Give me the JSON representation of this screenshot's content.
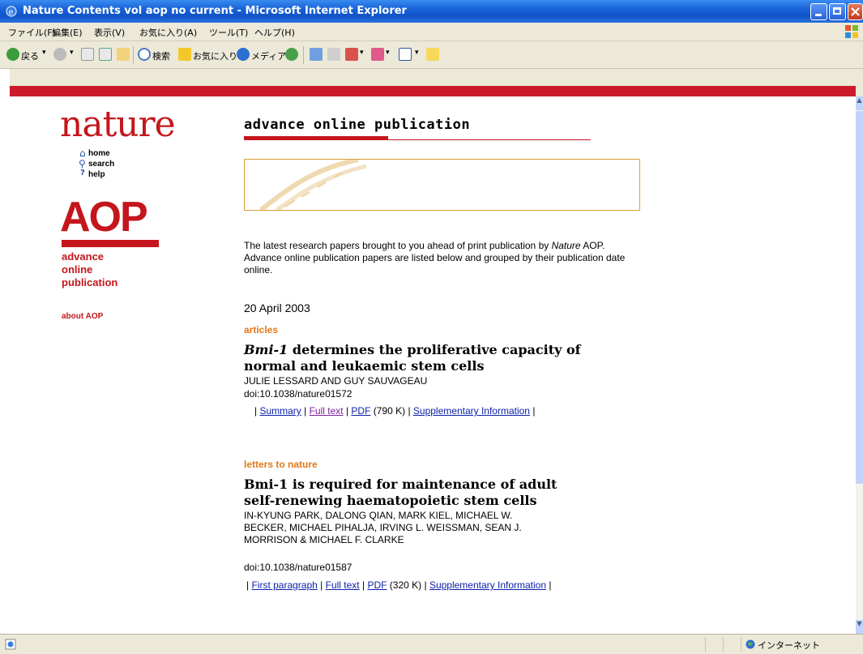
{
  "window": {
    "title": "Nature Contents vol aop no current - Microsoft Internet Explorer"
  },
  "menu": [
    "ファイル(F)",
    "編集(E)",
    "表示(V)",
    "お気に入り(A)",
    "ツール(T)",
    "ヘルプ(H)"
  ],
  "toolbar": {
    "back": "戻る",
    "search": "検索",
    "favorites": "お気に入り",
    "media": "メディア"
  },
  "status": {
    "zone": "インターネット"
  },
  "page": {
    "logo": "nature",
    "nav": [
      "home",
      "search",
      "help"
    ],
    "aop": "AOP",
    "aop_sub": [
      "advance",
      "online",
      "publication"
    ],
    "about": "about AOP",
    "heading": "advance online publication",
    "intro_before": "The latest research papers brought to you ahead of print publication by ",
    "intro_italic": "Nature",
    "intro_after": " AOP. Advance online publication papers are listed below and grouped by their publication date online.",
    "date": "20 April 2003",
    "sections": [
      {
        "label": "articles",
        "title_italic": "Bmi-1",
        "title_rest": " determines the proliferative capacity of normal and leukaemic stem cells",
        "authors": "JULIE LESSARD AND GUY SAUVAGEAU",
        "doi": "doi:10.1038/nature01572",
        "link1": "Summary",
        "link2": "Full text",
        "link3": "PDF",
        "size": "(790  K)",
        "link4": "Supplementary Information"
      },
      {
        "label": "letters to nature",
        "title": "Bmi-1 is required for maintenance of adult self-renewing haematopoietic stem cells",
        "authors": "IN-KYUNG PARK, DALONG QIAN, MARK KIEL, MICHAEL W. BECKER, MICHAEL PIHALJA, IRVING L. WEISSMAN, SEAN J. MORRISON & MICHAEL F. CLARKE",
        "doi": "doi:10.1038/nature01587",
        "link1": "First paragraph",
        "link2": "Full text",
        "link3": "PDF",
        "size": "(320  K)",
        "link4": "Supplementary Information"
      }
    ]
  },
  "colors": {
    "brand_red": "#c4161c",
    "section_orange": "#e07818",
    "link_blue": "#0b1fa8",
    "visited_purple": "#7d1fa0"
  }
}
